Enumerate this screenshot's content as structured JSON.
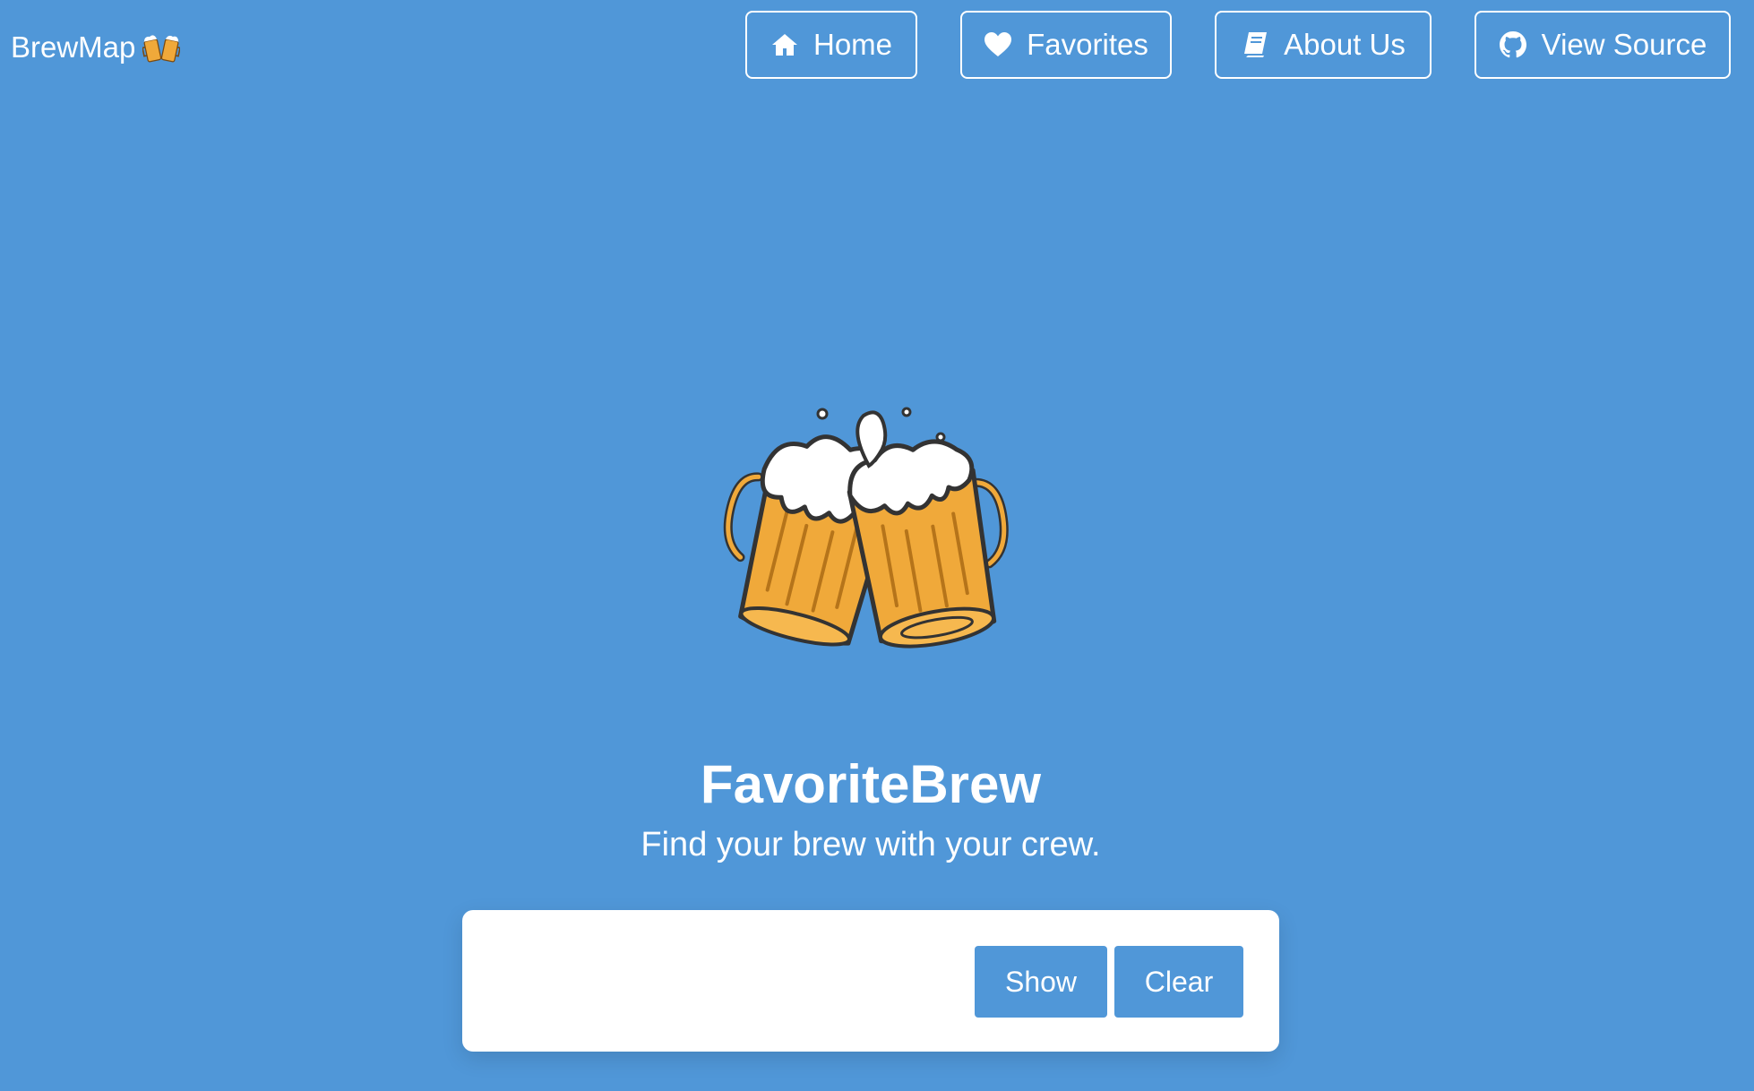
{
  "header": {
    "brand": "BrewMap",
    "brand_icon": "beer-mugs-emoji"
  },
  "nav": [
    {
      "label": "Home",
      "icon": "home-icon"
    },
    {
      "label": "Favorites",
      "icon": "heart-icon"
    },
    {
      "label": "About Us",
      "icon": "book-icon"
    },
    {
      "label": "View Source",
      "icon": "github-icon"
    }
  ],
  "hero": {
    "image": "clinking-beer-mugs-illustration",
    "title": "FavoriteBrew",
    "subtitle": "Find your brew with your crew."
  },
  "card": {
    "show_label": "Show",
    "clear_label": "Clear"
  },
  "colors": {
    "background": "#5097d8",
    "beer": "#f0a93a",
    "foam": "#ffffff",
    "outline": "#333333"
  }
}
